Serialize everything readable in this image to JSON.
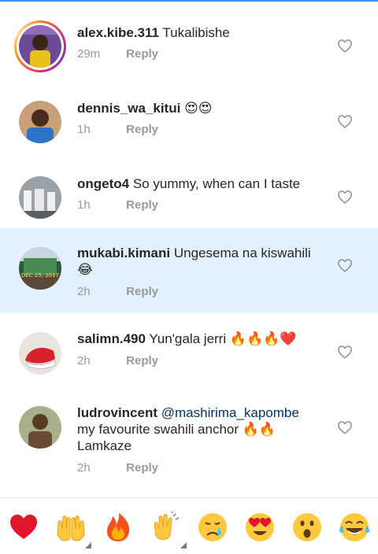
{
  "comments": [
    {
      "username": "alex.kibe.311",
      "text": "Tukalibishe",
      "time": "29m",
      "reply": "Reply",
      "story_ring": true,
      "highlighted": false
    },
    {
      "username": "dennis_wa_kitui",
      "text": "😍😍",
      "time": "1h",
      "reply": "Reply",
      "story_ring": false,
      "highlighted": false
    },
    {
      "username": "ongeto4",
      "text": "So yummy, when can I taste",
      "time": "1h",
      "reply": "Reply",
      "story_ring": false,
      "highlighted": false
    },
    {
      "username": "mukabi.kimani",
      "text": "Ungesema na kiswahili",
      "text_line2": "😂",
      "avatar_caption": "DEC 25, 2017",
      "time": "2h",
      "reply": "Reply",
      "story_ring": false,
      "highlighted": true
    },
    {
      "username": "salimn.490",
      "text": "Yun'gala jerri",
      "time": "2h",
      "reply": "Reply",
      "story_ring": false,
      "highlighted": false
    },
    {
      "username": "ludrovincent",
      "mention": "@mashirima_kapombe",
      "text_line2": "my favourite swahili anchor",
      "text_line3": "Lamkaze",
      "time": "2h",
      "reply": "Reply",
      "story_ring": false,
      "highlighted": false
    }
  ],
  "colors": {
    "accent": "#3897f0",
    "highlight_bg": "#e3f0fd",
    "meta_gray": "#999999",
    "mention": "#003569"
  },
  "emoji_bar": [
    "heart",
    "raising-hands",
    "fire",
    "clapping-hands",
    "crying-face",
    "heart-eyes-face",
    "surprised-face",
    "tears-of-joy-face"
  ]
}
